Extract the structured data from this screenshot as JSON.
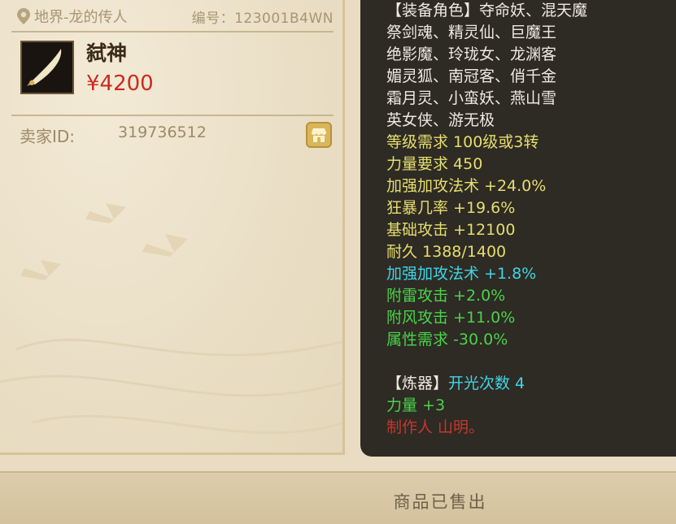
{
  "listing": {
    "location": "地界-龙的传人",
    "serial_label": "编号：",
    "serial": "123001B4WN",
    "item_name": "弑神",
    "price": "¥4200",
    "seller_label": "卖家ID:",
    "seller_id": "319736512"
  },
  "details": {
    "roles_lines": [
      "【装备角色】夺命妖、混天魔",
      "祭剑魂、精灵仙、巨魔王",
      "绝影魔、玲珑女、龙渊客",
      "媚灵狐、南冠客、俏千金",
      "霜月灵、小蛮妖、燕山雪",
      "英女侠、游无极"
    ],
    "base_stats": [
      "等级需求 100级或3转",
      "力量要求 450",
      "加强加攻法术 +24.0%",
      "狂暴几率 +19.6%",
      "基础攻击 +12100",
      "耐久 1388/1400"
    ],
    "bonus_cyan": "加强加攻法术 +1.8%",
    "bonus_green": [
      "附雷攻击 +2.0%",
      "附风攻击 +11.0%",
      "属性需求 -30.0%"
    ],
    "refine_label": "【炼器】",
    "refine_value": "开光次数 4",
    "strength_bonus": "力量 +3",
    "maker": "制作人 山明。"
  },
  "status": {
    "sold_text": "商品已售出"
  },
  "colors": {
    "price": "#cc2a1f",
    "stat_yellow": "#e6de6e",
    "stat_cyan": "#3fd6e6",
    "stat_green": "#4ad34a",
    "maker_red": "#c8362b",
    "panel_bg": "#2e2a24"
  },
  "icons": {
    "location": "map-pin-icon",
    "shop": "shop-icon",
    "item": "sword-icon"
  }
}
